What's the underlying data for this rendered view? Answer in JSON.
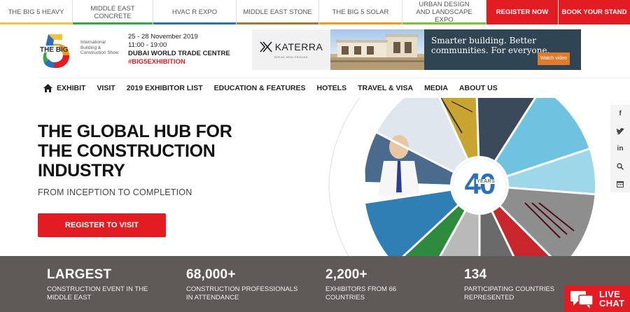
{
  "top_tabs": [
    {
      "label": "THE BIG 5 HEAVY",
      "color": "#f2c43b"
    },
    {
      "label": "MIDDLE EAST CONCRETE",
      "color": "#37a34a"
    },
    {
      "label": "HVAC R EXPO",
      "color": "#2d6fb8"
    },
    {
      "label": "MIDDLE EAST STONE",
      "color": "#9b7b3a"
    },
    {
      "label": "THE BIG 5 SOLAR",
      "color": "#f39c12"
    },
    {
      "label": "URBAN DESIGN AND LANDSCAPE EXPO",
      "color": "#7bbf3b"
    }
  ],
  "top_cta": {
    "register": "REGISTER NOW",
    "book": "BOOK YOUR STAND"
  },
  "logo": {
    "text": "THE BIG",
    "number": "5",
    "tagline": "International Building & Construction Show"
  },
  "event": {
    "dates": "25 - 28 November 2019",
    "hours": "11:00 - 19:00",
    "venue": "DUBAI WORLD TRADE CENTRE",
    "hashtag": "#BIG5EXHIBITION"
  },
  "ad": {
    "brand": "KATERRA",
    "brand_tagline": "BREAK NEW GROUND",
    "headline": "Smarter building. Better communities. For everyone.",
    "button": "Watch video"
  },
  "nav": {
    "items": [
      "EXHIBIT",
      "VISIT",
      "2019 EXHIBITOR LIST",
      "EDUCATION & FEATURES",
      "HOTELS",
      "TRAVEL & VISA",
      "MEDIA",
      "ABOUT US"
    ]
  },
  "hero": {
    "title": "THE GLOBAL HUB FOR THE CONSTRUCTION INDUSTRY",
    "subtitle": "FROM INCEPTION TO COMPLETION",
    "button": "REGISTER TO VISIT",
    "badge_number": "40",
    "badge_text": "YEARS"
  },
  "social": [
    "facebook-icon",
    "twitter-icon",
    "linkedin-icon",
    "search-icon",
    "calendar-icon"
  ],
  "stats": [
    {
      "value": "LARGEST",
      "label": "CONSTRUCTION EVENT IN THE MIDDLE EAST"
    },
    {
      "value": "68,000+",
      "label": "CONSTRUCTION PROFESSIONALS IN ATTENDANCE"
    },
    {
      "value": "2,200+",
      "label": "EXHIBITORS FROM 66 COUNTRIES"
    },
    {
      "value": "134",
      "label": "PARTICIPATING COUNTRIES REPRESENTED"
    }
  ],
  "livechat": {
    "line1": "LIVE",
    "line2": "CHAT"
  },
  "colors": {
    "accent": "#e31b23",
    "stats_bg": "#5f5a57",
    "ad_bg": "#2f4553"
  }
}
